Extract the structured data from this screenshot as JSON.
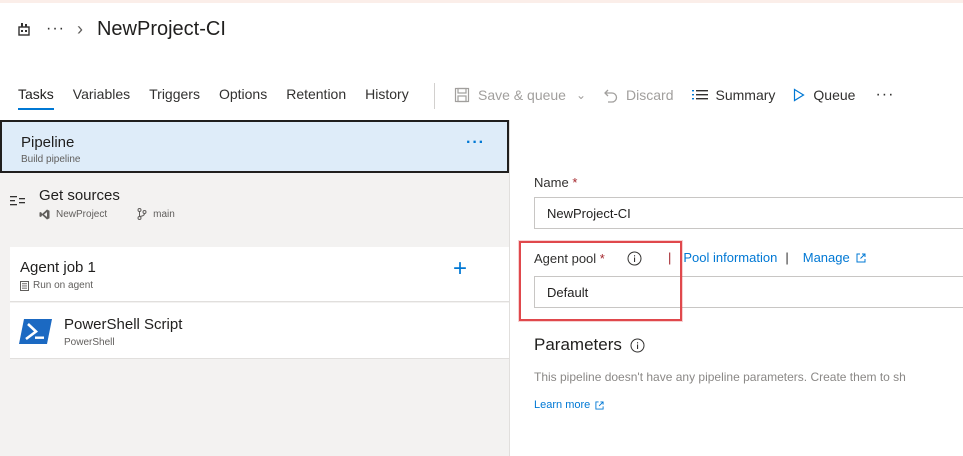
{
  "header": {
    "more_label": "···",
    "title": "NewProject-CI"
  },
  "tabs": [
    {
      "label": "Tasks",
      "active": true
    },
    {
      "label": "Variables"
    },
    {
      "label": "Triggers"
    },
    {
      "label": "Options"
    },
    {
      "label": "Retention"
    },
    {
      "label": "History"
    }
  ],
  "toolbar": {
    "save_queue": "Save & queue",
    "discard": "Discard",
    "summary": "Summary",
    "queue": "Queue",
    "more": "···"
  },
  "pipeline": {
    "title": "Pipeline",
    "subtitle": "Build pipeline",
    "more": "···"
  },
  "get_sources": {
    "title": "Get sources",
    "repo": "NewProject",
    "branch": "main"
  },
  "agent_job": {
    "title": "Agent job 1",
    "subtitle": "Run on agent",
    "add": "+"
  },
  "task": {
    "title": "PowerShell Script",
    "subtitle": "PowerShell"
  },
  "form": {
    "name_label": "Name",
    "name_value": "NewProject-CI",
    "agent_pool_label": "Agent pool",
    "agent_pool_value": "Default",
    "required_marker": "*",
    "separator": "|",
    "pool_information": "Pool information",
    "manage": "Manage",
    "parameters_heading": "Parameters",
    "parameters_desc": "This pipeline doesn't have any pipeline parameters. Create them to sh",
    "learn_more": "Learn more"
  },
  "colors": {
    "accent": "#0078d4",
    "selected_bg": "#deecf9",
    "highlight": "#e0484c",
    "required": "#a4262c"
  }
}
